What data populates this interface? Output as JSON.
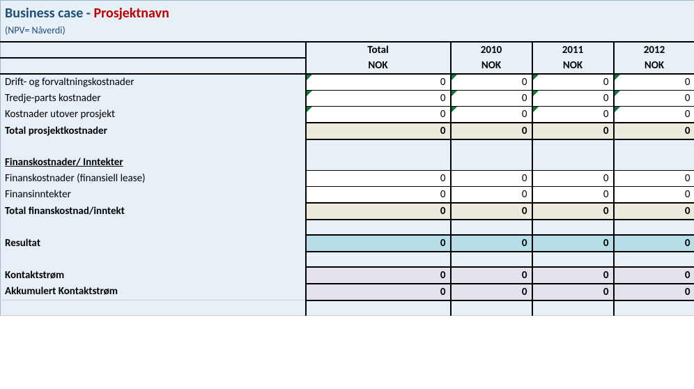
{
  "title": {
    "prefix": "Business case - ",
    "project": "Prosjektnavn",
    "subtitle": "(NPV= Nåverdi)"
  },
  "columns": {
    "total": {
      "label": "Total",
      "currency": "NOK"
    },
    "y1": {
      "label": "2010",
      "currency": "NOK"
    },
    "y2": {
      "label": "2011",
      "currency": "NOK"
    },
    "y3": {
      "label": "2012",
      "currency": "NOK"
    }
  },
  "rows": {
    "drift": {
      "label": "Drift- og forvaltningskostnader",
      "total": "0",
      "y1": "0",
      "y2": "0",
      "y3": "0"
    },
    "tredje": {
      "label": "Tredje-parts kostnader",
      "total": "0",
      "y1": "0",
      "y2": "0",
      "y3": "0"
    },
    "utover": {
      "label": "Kostnader utover prosjekt",
      "total": "0",
      "y1": "0",
      "y2": "0",
      "y3": "0"
    },
    "totproj": {
      "label": "Total prosjektkostnader",
      "total": "0",
      "y1": "0",
      "y2": "0",
      "y3": "0"
    },
    "finsection": {
      "label": "Finanskostnader/ Inntekter"
    },
    "finkost": {
      "label": "Finanskostnader (finansiell lease)",
      "total": "0",
      "y1": "0",
      "y2": "0",
      "y3": "0"
    },
    "fininn": {
      "label": "Finansinntekter",
      "total": "0",
      "y1": "0",
      "y2": "0",
      "y3": "0"
    },
    "totfin": {
      "label": "Total finanskostnad/inntekt",
      "total": "0",
      "y1": "0",
      "y2": "0",
      "y3": "0"
    },
    "resultat": {
      "label": "Resultat",
      "total": "0",
      "y1": "0",
      "y2": "0",
      "y3": "0"
    },
    "kontakt": {
      "label": "Kontaktstrøm",
      "total": "0",
      "y1": "0",
      "y2": "0",
      "y3": "0"
    },
    "akk": {
      "label": "Akkumulert Kontaktstrøm",
      "total": "0",
      "y1": "0",
      "y2": "0",
      "y3": "0"
    }
  }
}
